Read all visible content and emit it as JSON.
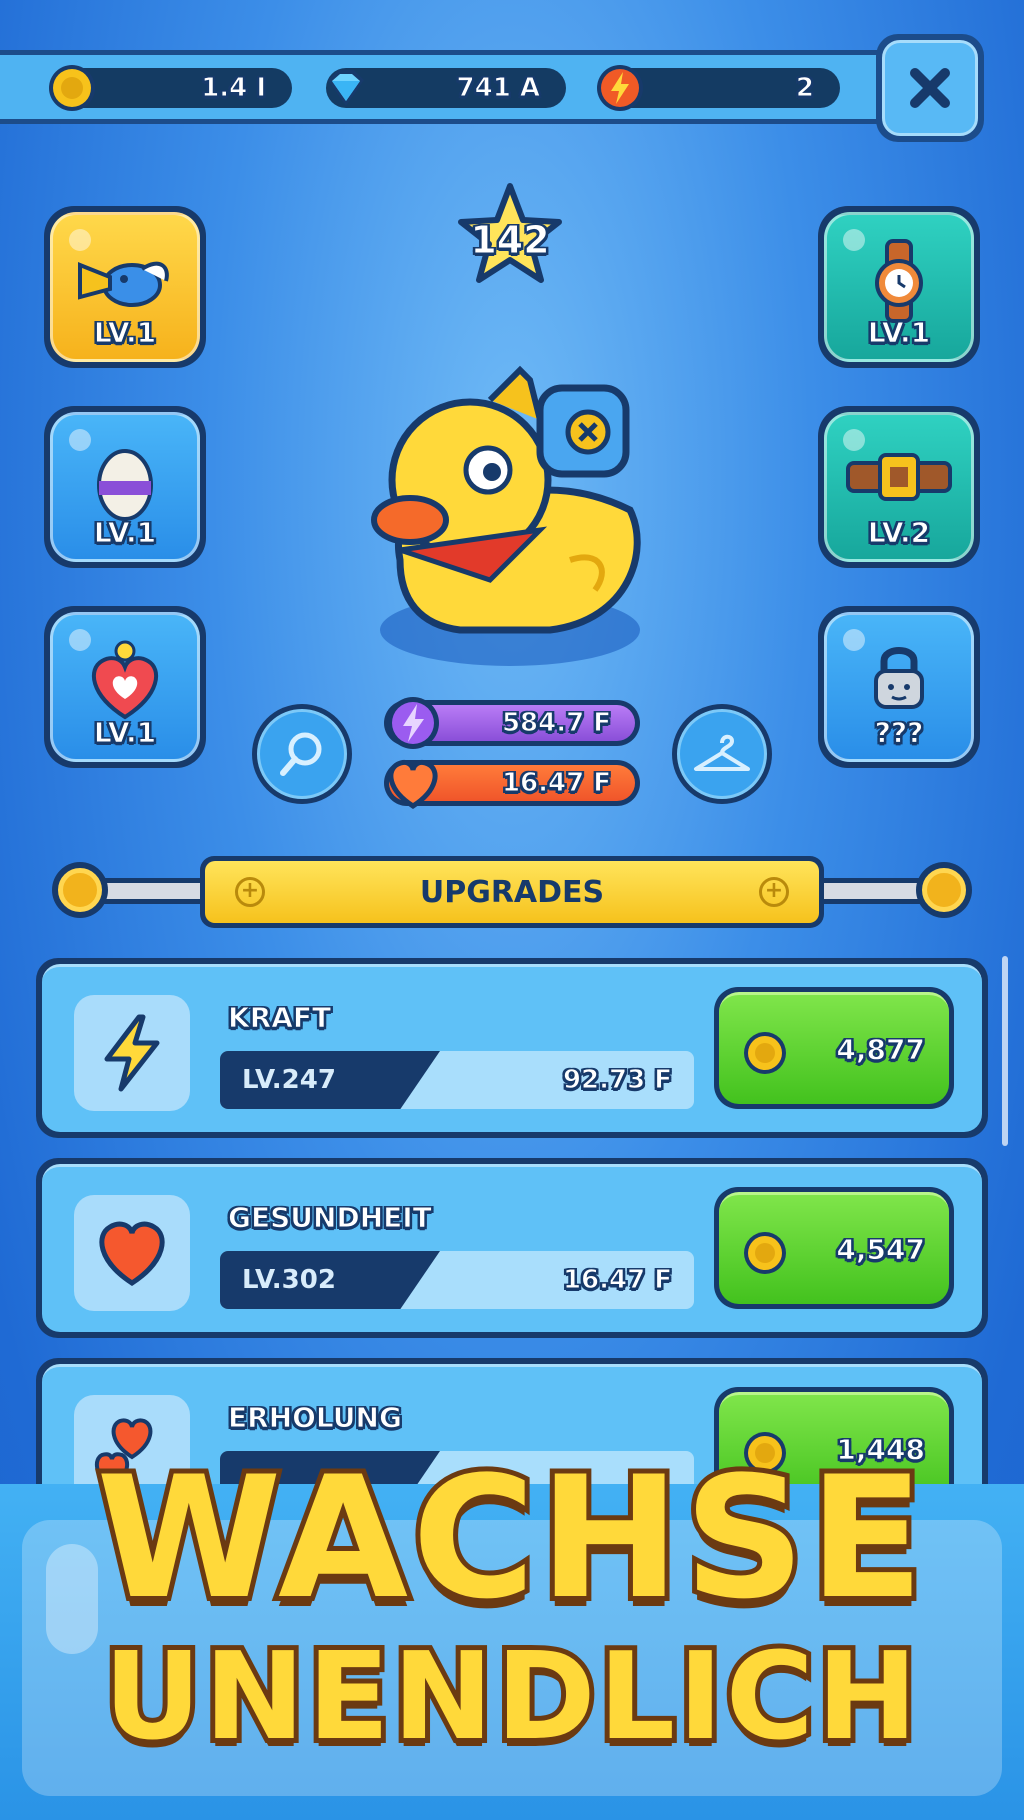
{
  "resources": {
    "coins": "1.4 I",
    "gems": "741 A",
    "energy": "2"
  },
  "player": {
    "level": "142",
    "power": "584.7 F",
    "health": "16.47 F"
  },
  "slots": {
    "left": [
      {
        "label": "LV.1",
        "icon": "trumpet-bird-icon",
        "color": "yellow"
      },
      {
        "label": "LV.1",
        "icon": "egg-icon",
        "color": "blue"
      },
      {
        "label": "LV.1",
        "icon": "heart-chick-icon",
        "color": "blue"
      }
    ],
    "right": [
      {
        "label": "LV.1",
        "icon": "watch-icon",
        "color": "teal"
      },
      {
        "label": "LV.2",
        "icon": "belt-icon",
        "color": "teal"
      },
      {
        "label": "???",
        "icon": "lock-icon",
        "color": "blue"
      }
    ]
  },
  "upgrades": {
    "header": "UPGRADES",
    "items": [
      {
        "name": "KRAFT",
        "level": "LV.247",
        "value": "92.73 F",
        "cost": "4,877",
        "icon": "lightning-icon"
      },
      {
        "name": "GESUNDHEIT",
        "level": "LV.302",
        "value": "16.47 F",
        "cost": "4,547",
        "icon": "heart-icon"
      },
      {
        "name": "ERHOLUNG",
        "level": "",
        "value": "",
        "cost": "1,448",
        "icon": "hearts-icon"
      }
    ]
  },
  "promo": {
    "line1": "WACHSE",
    "line2": "UNENDLICH"
  },
  "colors": {
    "background": "#1e6fd8",
    "outline": "#173a6b",
    "gold": "#ffd93a",
    "green": "#43c21e"
  }
}
